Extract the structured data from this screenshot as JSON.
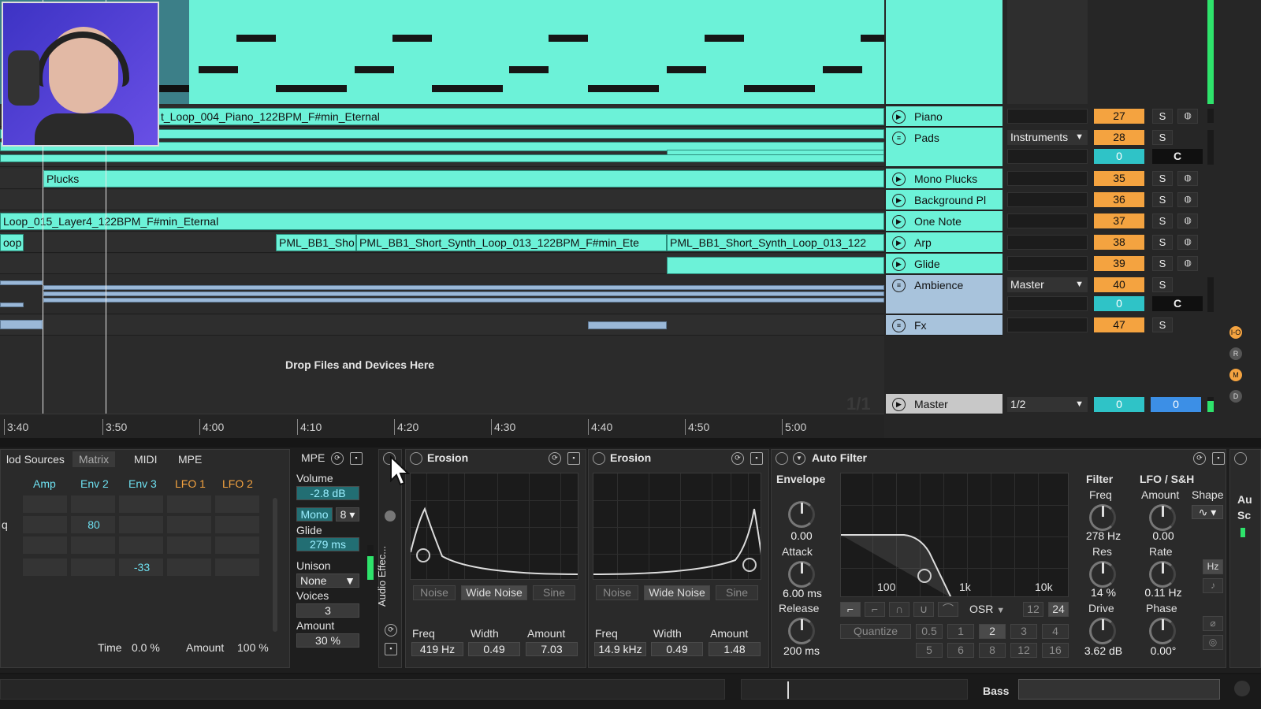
{
  "arrangement": {
    "clips": {
      "piano_clip": "t_Loop_004_Piano_122BPM_F#min_Eternal",
      "plucks_clip": "Plucks",
      "layer4_clip": "Loop_015_Layer4_122BPM_F#min_Eternal",
      "loop_clip": "oop",
      "synth_clip_1": "PML_BB1_Sho",
      "synth_clip_2": "PML_BB1_Short_Synth_Loop_013_122BPM_F#min_Ete",
      "synth_clip_3": "PML_BB1_Short_Synth_Loop_013_122"
    },
    "drop_text": "Drop Files and Devices Here",
    "loop_fraction": "1/1",
    "ruler": [
      "3:40",
      "3:50",
      "4:00",
      "4:10",
      "4:20",
      "4:30",
      "4:40",
      "4:50",
      "5:00"
    ]
  },
  "tracks": [
    {
      "name": "Piano",
      "number": "27",
      "icon": "play-icon"
    },
    {
      "name": "Pads",
      "number": "28",
      "number2": "0",
      "routing": "Instruments",
      "icon": "group-icon"
    },
    {
      "name": "Mono Plucks",
      "number": "35",
      "icon": "play-icon"
    },
    {
      "name": "Background Pl",
      "number": "36",
      "icon": "play-icon"
    },
    {
      "name": "One Note",
      "number": "37",
      "icon": "play-icon"
    },
    {
      "name": "Arp",
      "number": "38",
      "icon": "play-icon"
    },
    {
      "name": "Glide",
      "number": "39",
      "icon": "play-icon"
    },
    {
      "name": "Ambience",
      "number": "40",
      "number2": "0",
      "routing": "Master",
      "icon": "group-icon"
    },
    {
      "name": "Fx",
      "number": "47",
      "icon": "group-icon"
    }
  ],
  "master": {
    "name": "Master",
    "routing": "1/2",
    "vol": "0",
    "pan": "0"
  },
  "buttons": {
    "solo": "S",
    "center": "C"
  },
  "side_buttons": [
    "I-O",
    "R",
    "M",
    "D"
  ],
  "synth": {
    "tabs": [
      "lod Sources",
      "Matrix",
      "MIDI",
      "MPE"
    ],
    "mpe_label": "MPE",
    "matrix_cols": [
      "Amp",
      "Env 2",
      "Env 3",
      "LFO 1",
      "LFO 2"
    ],
    "row_label": "q",
    "val_80": "80",
    "val_neg33": "-33",
    "volume_label": "Volume",
    "volume_value": "-2.8 dB",
    "mono_label": "Mono",
    "mono_voices": "8",
    "glide_label": "Glide",
    "glide_value": "279 ms",
    "unison_label": "Unison",
    "unison_value": "None",
    "voices_label": "Voices",
    "voices_value": "3",
    "amount_label": "Amount",
    "amount_value": "30 %",
    "time_label": "Time",
    "time_value": "0.0 %",
    "amount2_label": "Amount",
    "amount2_value": "100 %"
  },
  "rack_label": "Audio Effec...",
  "erosion1": {
    "title": "Erosion",
    "modes": [
      "Noise",
      "Wide Noise",
      "Sine"
    ],
    "freq_label": "Freq",
    "freq_value": "419 Hz",
    "width_label": "Width",
    "width_value": "0.49",
    "amount_label": "Amount",
    "amount_value": "7.03"
  },
  "erosion2": {
    "title": "Erosion",
    "modes": [
      "Noise",
      "Wide Noise",
      "Sine"
    ],
    "freq_label": "Freq",
    "freq_value": "14.9 kHz",
    "width_label": "Width",
    "width_value": "0.49",
    "amount_label": "Amount",
    "amount_value": "1.48"
  },
  "autofilter": {
    "title": "Auto Filter",
    "envelope_label": "Envelope",
    "env_amount": "0.00",
    "attack_label": "Attack",
    "attack_value": "6.00 ms",
    "release_label": "Release",
    "release_value": "200 ms",
    "freq_ticks": [
      "100",
      "1k",
      "10k"
    ],
    "osr": "OSR",
    "slope_12": "12",
    "slope_24": "24",
    "quantize": "Quantize",
    "quant_values": [
      "0.5",
      "1",
      "2",
      "3",
      "4",
      "5",
      "6",
      "8",
      "12",
      "16"
    ],
    "filter_label": "Filter",
    "freq_label": "Freq",
    "freq_value": "278 Hz",
    "res_label": "Res",
    "res_value": "14 %",
    "drive_label": "Drive",
    "drive_value": "3.62 dB",
    "lfo_label": "LFO / S&H",
    "lfo_amount_label": "Amount",
    "lfo_amount_value": "0.00",
    "shape_label": "Shape",
    "rate_label": "Rate",
    "rate_value": "0.11 Hz",
    "hz_label": "Hz",
    "phase_label": "Phase",
    "phase_value": "0.00°"
  },
  "partial_next": {
    "line1": "Au",
    "line2": "Sc"
  },
  "bottom": {
    "track_name": "Bass"
  }
}
